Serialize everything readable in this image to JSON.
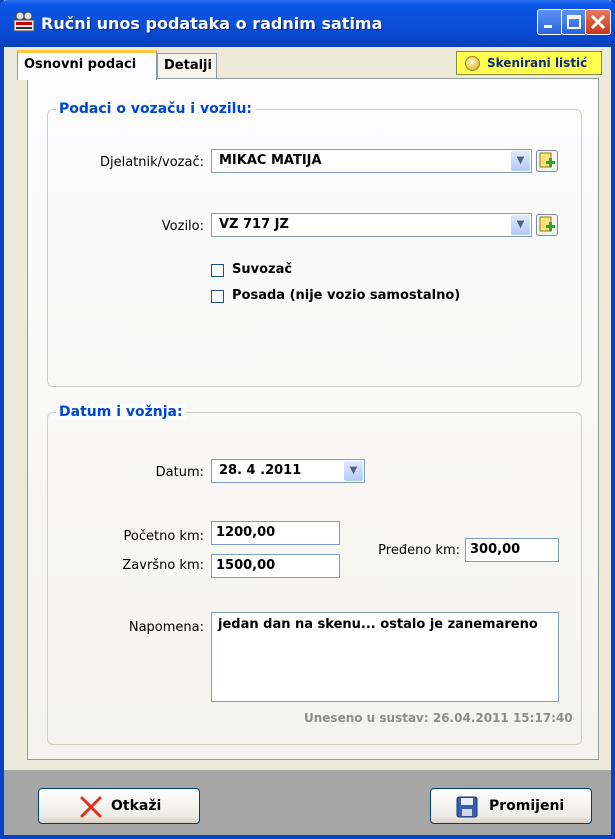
{
  "window": {
    "title": "Ručni unos podataka o radnim satima",
    "app_icon": "film-reel-icon"
  },
  "tabs": [
    {
      "label": "Osnovni podaci",
      "active": true
    },
    {
      "label": "Detalji",
      "active": false
    }
  ],
  "scan_button": {
    "label": "Skenirani listić",
    "icon": "arrow-circle-icon"
  },
  "driver_vehicle": {
    "legend": "Podaci o vozaču i vozilu:",
    "driver_label": "Djelatnik/vozač:",
    "driver_value": "MIKAC MATIJA",
    "vehicle_label": "Vozilo:",
    "vehicle_value": "VZ 717 JZ",
    "codriver_label": "Suvozač",
    "codriver_checked": false,
    "crew_label": "Posada (nije vozio samostalno)",
    "crew_checked": false
  },
  "date_trip": {
    "legend": "Datum i vožnja:",
    "date_label": "Datum:",
    "date_value": "28. 4 .2011",
    "start_km_label": "Početno km:",
    "start_km_value": "1200,00",
    "end_km_label": "Završno km:",
    "end_km_value": "1500,00",
    "distance_label": "Pređeno km:",
    "distance_value": "300,00",
    "note_label": "Napomena:",
    "note_value": "jedan dan na skenu... ostalo je zanemareno",
    "entered_text": "Uneseno u sustav: 26.04.2011 15:17:40"
  },
  "buttons": {
    "cancel_label": "Otkaži",
    "save_label": "Promijeni"
  },
  "colors": {
    "title_bar": "#0a4fdb",
    "legend_text": "#0046d5",
    "scan_button_bg": "#ffff50"
  }
}
